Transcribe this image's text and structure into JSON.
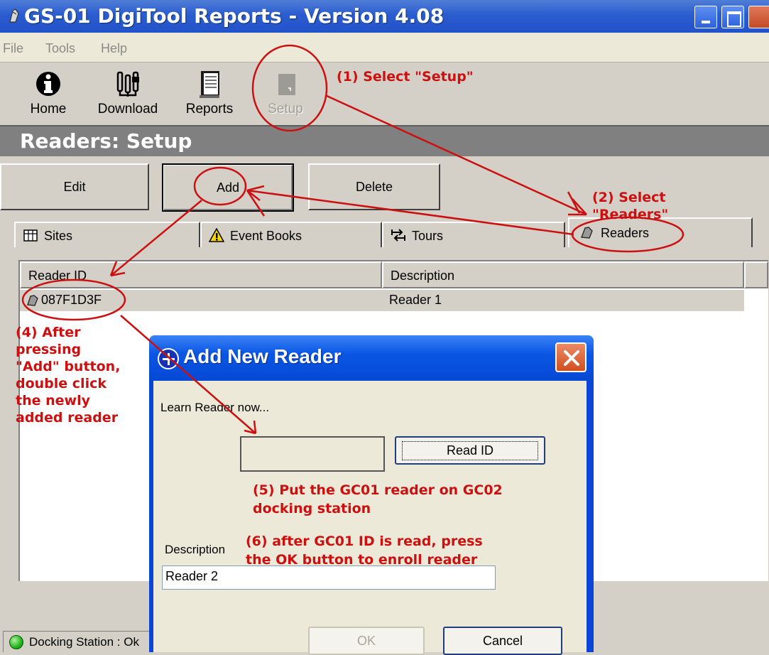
{
  "window": {
    "title": "GS-01 DigiTool Reports - Version 4.08"
  },
  "menu": [
    "File",
    "Tools",
    "Help"
  ],
  "toolbar": {
    "home": "Home",
    "download": "Download",
    "reports": "Reports",
    "setup": "Setup"
  },
  "section": {
    "title": "Readers: Setup"
  },
  "actions": {
    "edit": "Edit",
    "add": "Add",
    "delete": "Delete"
  },
  "tabs": [
    "Sites",
    "Event Books",
    "Tours",
    "Readers"
  ],
  "table": {
    "columns": [
      "Reader ID",
      "Description"
    ],
    "rows": [
      {
        "id": "087F1D3F",
        "description": "Reader 1"
      }
    ]
  },
  "status": {
    "text": "Docking Station : Ok"
  },
  "dialog": {
    "title": "Add New Reader",
    "prompt": "Learn Reader now...",
    "read_button": "Read ID",
    "description_label": "Description",
    "description_value": "Reader 2",
    "ok": "OK",
    "cancel": "Cancel"
  },
  "annotations": {
    "step1": "(1) Select \"Setup\"",
    "step2_line1": "(2) Select",
    "step2_line2": "\"Readers\"",
    "step4": [
      "(4) After",
      "pressing",
      "\"Add\" button,",
      "double click",
      "the newly",
      "added reader"
    ],
    "step5_line1": "(5) Put the GC01 reader on GC02",
    "step5_line2": "docking station",
    "step6_line1": "(6) after GC01 ID is read, press",
    "step6_line2": "the OK button to enroll reader"
  },
  "colors": {
    "title_blue": "#2b5ccf",
    "annotation_red": "#cc1010",
    "header_gray": "#808080"
  }
}
